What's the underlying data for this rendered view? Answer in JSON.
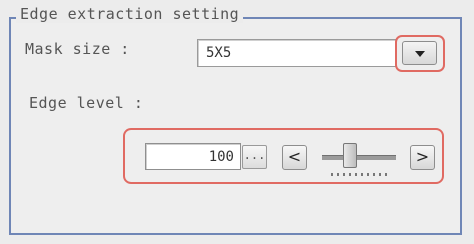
{
  "group": {
    "title": "Edge extraction setting"
  },
  "mask_size": {
    "label": "Mask size :",
    "value": "5X5"
  },
  "edge_level": {
    "label": "Edge level :",
    "value": "100",
    "ellipsis_label": "...",
    "decrement_label": "<",
    "increment_label": ">"
  },
  "colors": {
    "group_border": "#6f86b6",
    "highlight": "#e06a62"
  }
}
